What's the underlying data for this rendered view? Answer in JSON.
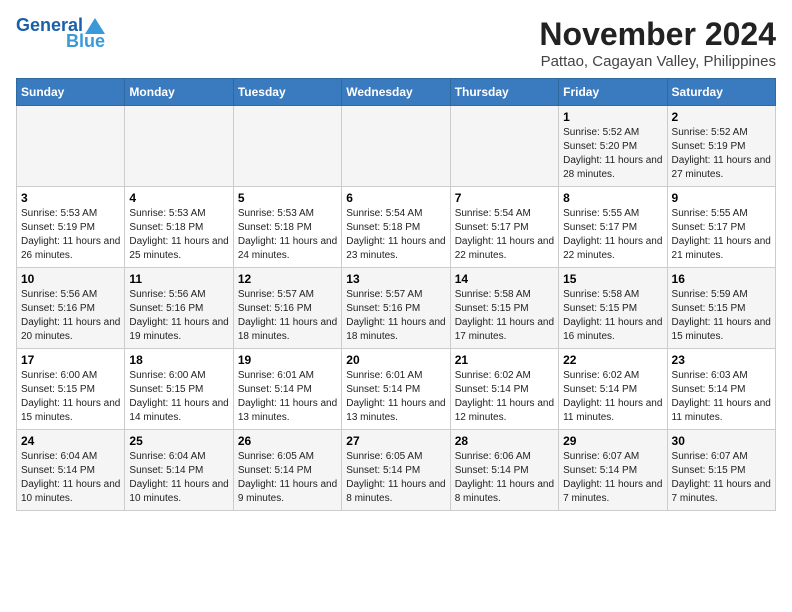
{
  "header": {
    "logo_line1": "General",
    "logo_line2": "Blue",
    "title": "November 2024",
    "subtitle": "Pattao, Cagayan Valley, Philippines"
  },
  "days_of_week": [
    "Sunday",
    "Monday",
    "Tuesday",
    "Wednesday",
    "Thursday",
    "Friday",
    "Saturday"
  ],
  "weeks": [
    [
      {
        "day": "",
        "info": ""
      },
      {
        "day": "",
        "info": ""
      },
      {
        "day": "",
        "info": ""
      },
      {
        "day": "",
        "info": ""
      },
      {
        "day": "",
        "info": ""
      },
      {
        "day": "1",
        "info": "Sunrise: 5:52 AM\nSunset: 5:20 PM\nDaylight: 11 hours and 28 minutes."
      },
      {
        "day": "2",
        "info": "Sunrise: 5:52 AM\nSunset: 5:19 PM\nDaylight: 11 hours and 27 minutes."
      }
    ],
    [
      {
        "day": "3",
        "info": "Sunrise: 5:53 AM\nSunset: 5:19 PM\nDaylight: 11 hours and 26 minutes."
      },
      {
        "day": "4",
        "info": "Sunrise: 5:53 AM\nSunset: 5:18 PM\nDaylight: 11 hours and 25 minutes."
      },
      {
        "day": "5",
        "info": "Sunrise: 5:53 AM\nSunset: 5:18 PM\nDaylight: 11 hours and 24 minutes."
      },
      {
        "day": "6",
        "info": "Sunrise: 5:54 AM\nSunset: 5:18 PM\nDaylight: 11 hours and 23 minutes."
      },
      {
        "day": "7",
        "info": "Sunrise: 5:54 AM\nSunset: 5:17 PM\nDaylight: 11 hours and 22 minutes."
      },
      {
        "day": "8",
        "info": "Sunrise: 5:55 AM\nSunset: 5:17 PM\nDaylight: 11 hours and 22 minutes."
      },
      {
        "day": "9",
        "info": "Sunrise: 5:55 AM\nSunset: 5:17 PM\nDaylight: 11 hours and 21 minutes."
      }
    ],
    [
      {
        "day": "10",
        "info": "Sunrise: 5:56 AM\nSunset: 5:16 PM\nDaylight: 11 hours and 20 minutes."
      },
      {
        "day": "11",
        "info": "Sunrise: 5:56 AM\nSunset: 5:16 PM\nDaylight: 11 hours and 19 minutes."
      },
      {
        "day": "12",
        "info": "Sunrise: 5:57 AM\nSunset: 5:16 PM\nDaylight: 11 hours and 18 minutes."
      },
      {
        "day": "13",
        "info": "Sunrise: 5:57 AM\nSunset: 5:16 PM\nDaylight: 11 hours and 18 minutes."
      },
      {
        "day": "14",
        "info": "Sunrise: 5:58 AM\nSunset: 5:15 PM\nDaylight: 11 hours and 17 minutes."
      },
      {
        "day": "15",
        "info": "Sunrise: 5:58 AM\nSunset: 5:15 PM\nDaylight: 11 hours and 16 minutes."
      },
      {
        "day": "16",
        "info": "Sunrise: 5:59 AM\nSunset: 5:15 PM\nDaylight: 11 hours and 15 minutes."
      }
    ],
    [
      {
        "day": "17",
        "info": "Sunrise: 6:00 AM\nSunset: 5:15 PM\nDaylight: 11 hours and 15 minutes."
      },
      {
        "day": "18",
        "info": "Sunrise: 6:00 AM\nSunset: 5:15 PM\nDaylight: 11 hours and 14 minutes."
      },
      {
        "day": "19",
        "info": "Sunrise: 6:01 AM\nSunset: 5:14 PM\nDaylight: 11 hours and 13 minutes."
      },
      {
        "day": "20",
        "info": "Sunrise: 6:01 AM\nSunset: 5:14 PM\nDaylight: 11 hours and 13 minutes."
      },
      {
        "day": "21",
        "info": "Sunrise: 6:02 AM\nSunset: 5:14 PM\nDaylight: 11 hours and 12 minutes."
      },
      {
        "day": "22",
        "info": "Sunrise: 6:02 AM\nSunset: 5:14 PM\nDaylight: 11 hours and 11 minutes."
      },
      {
        "day": "23",
        "info": "Sunrise: 6:03 AM\nSunset: 5:14 PM\nDaylight: 11 hours and 11 minutes."
      }
    ],
    [
      {
        "day": "24",
        "info": "Sunrise: 6:04 AM\nSunset: 5:14 PM\nDaylight: 11 hours and 10 minutes."
      },
      {
        "day": "25",
        "info": "Sunrise: 6:04 AM\nSunset: 5:14 PM\nDaylight: 11 hours and 10 minutes."
      },
      {
        "day": "26",
        "info": "Sunrise: 6:05 AM\nSunset: 5:14 PM\nDaylight: 11 hours and 9 minutes."
      },
      {
        "day": "27",
        "info": "Sunrise: 6:05 AM\nSunset: 5:14 PM\nDaylight: 11 hours and 8 minutes."
      },
      {
        "day": "28",
        "info": "Sunrise: 6:06 AM\nSunset: 5:14 PM\nDaylight: 11 hours and 8 minutes."
      },
      {
        "day": "29",
        "info": "Sunrise: 6:07 AM\nSunset: 5:14 PM\nDaylight: 11 hours and 7 minutes."
      },
      {
        "day": "30",
        "info": "Sunrise: 6:07 AM\nSunset: 5:15 PM\nDaylight: 11 hours and 7 minutes."
      }
    ]
  ]
}
